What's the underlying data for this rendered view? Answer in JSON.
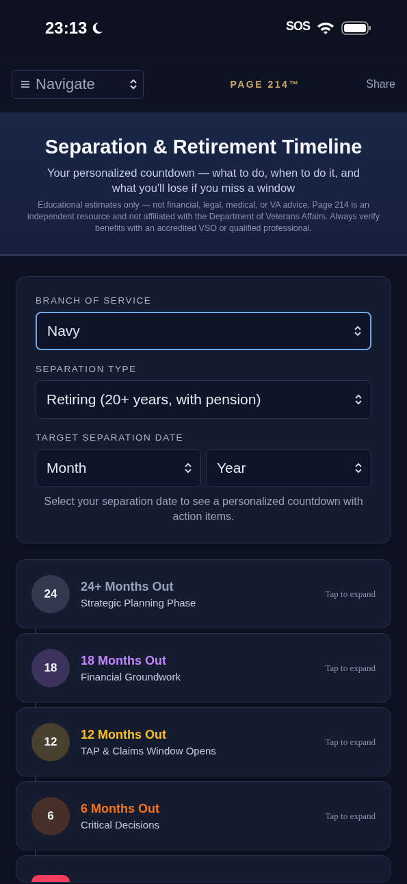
{
  "status_bar": {
    "time": "23:13",
    "sos": "SOS"
  },
  "header": {
    "navigate": "Navigate",
    "brand": "PAGE 214™",
    "share": "Share"
  },
  "hero": {
    "title": "Separation & Retirement Timeline",
    "subtitle": "Your personalized countdown — what to do, when to do it, and what you'll lose if you miss a window",
    "disclaimer": "Educational estimates only — not financial, legal, medical, or VA advice. Page 214 is an independent resource and not affiliated with the Department of Veterans Affairs. Always verify benefits with an accredited VSO or qualified professional."
  },
  "form": {
    "fields": [
      {
        "label": "BRANCH OF SERVICE",
        "selects": [
          {
            "value": "Navy",
            "focused": true
          }
        ]
      },
      {
        "label": "SEPARATION TYPE",
        "selects": [
          {
            "value": "Retiring (20+ years, with pension)",
            "focused": false
          }
        ]
      },
      {
        "label": "TARGET SEPARATION DATE",
        "selects": [
          {
            "value": "Month",
            "focused": false
          },
          {
            "value": "Year",
            "focused": false
          }
        ]
      }
    ],
    "hint": "Select your separation date to see a personalized countdown with action items."
  },
  "timeline": [
    {
      "badge": "24",
      "title": "24+ Months Out",
      "subtitle": "Strategic Planning Phase",
      "action": "Tap to expand",
      "color": "#94a3b8"
    },
    {
      "badge": "18",
      "title": "18 Months Out",
      "subtitle": "Financial Groundwork",
      "action": "Tap to expand",
      "color": "#c084fc"
    },
    {
      "badge": "12",
      "title": "12 Months Out",
      "subtitle": "TAP & Claims Window Opens",
      "action": "Tap to expand",
      "color": "#fbbf24"
    },
    {
      "badge": "6",
      "title": "6 Months Out",
      "subtitle": "Critical Decisions",
      "action": "Tap to expand",
      "color": "#f97316"
    },
    {
      "color": "#f43f5e"
    }
  ]
}
